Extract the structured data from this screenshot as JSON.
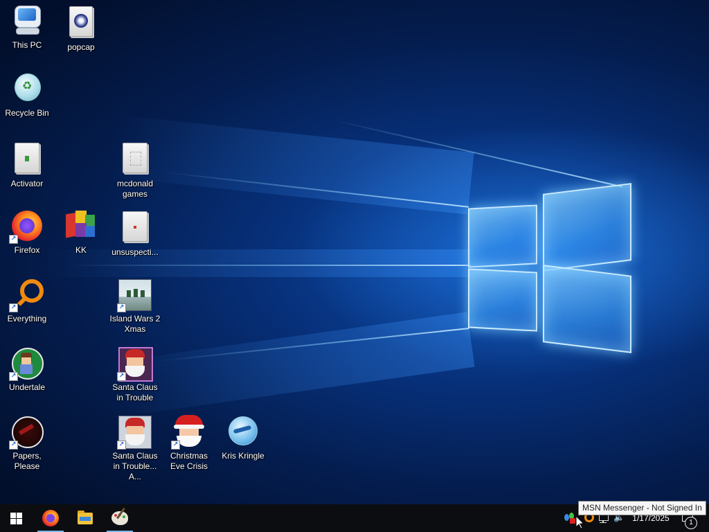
{
  "desktop": {
    "icons": [
      {
        "label": "This PC",
        "icon": "computer-icon"
      },
      {
        "label": "popcap",
        "icon": "popcap-icon"
      },
      {
        "label": "Recycle Bin",
        "icon": "recycle-bin-icon"
      },
      {
        "label": "Activator",
        "icon": "folder-icon"
      },
      {
        "label": "mcdonald games",
        "icon": "folder-icon"
      },
      {
        "label": "Firefox",
        "icon": "firefox-icon"
      },
      {
        "label": "KK",
        "icon": "kk-icon"
      },
      {
        "label": "unsuspecti...",
        "icon": "folder-icon"
      },
      {
        "label": "Everything",
        "icon": "everything-search-icon"
      },
      {
        "label": "Island Wars 2 Xmas",
        "icon": "island-wars-icon"
      },
      {
        "label": "Undertale",
        "icon": "undertale-icon"
      },
      {
        "label": "Santa Claus in Trouble",
        "icon": "santa-claus-icon"
      },
      {
        "label": "Papers, Please",
        "icon": "papers-please-icon"
      },
      {
        "label": "Santa Claus in Trouble... A...",
        "icon": "santa-claus-icon"
      },
      {
        "label": "Christmas Eve Crisis",
        "icon": "santa-face-icon"
      },
      {
        "label": "Kris Kringle",
        "icon": "kris-kringle-icon"
      }
    ]
  },
  "taskbar": {
    "pinned": [
      {
        "name": "start",
        "icon": "windows-logo-icon"
      },
      {
        "name": "firefox",
        "icon": "firefox-icon"
      },
      {
        "name": "file-explorer",
        "icon": "folder-icon"
      },
      {
        "name": "msn-paint",
        "icon": "palette-icon"
      }
    ],
    "tray": {
      "clock": "1/17/2025",
      "notification_count": "1",
      "tooltip": "MSN Messenger - Not Signed In"
    }
  },
  "colors": {
    "taskbar_bg": "#0c0d10",
    "active_indicator": "#76b9ed",
    "wallpaper_blue": "#0d4aa6"
  }
}
